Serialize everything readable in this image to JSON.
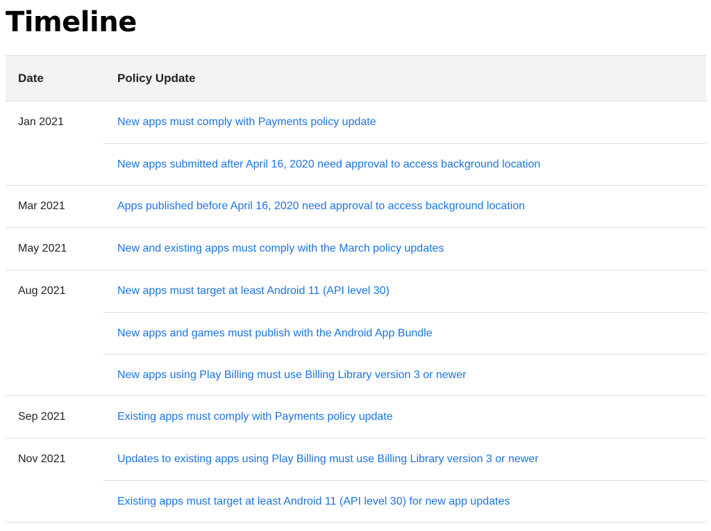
{
  "page": {
    "title": "Timeline"
  },
  "table": {
    "headers": {
      "date": "Date",
      "update": "Policy Update"
    },
    "groups": [
      {
        "date": "Jan 2021",
        "updates": [
          "New apps must comply with Payments policy update",
          "New apps submitted after April 16, 2020 need approval to access background location"
        ]
      },
      {
        "date": "Mar 2021",
        "updates": [
          "Apps published before April 16, 2020 need approval to access background location"
        ]
      },
      {
        "date": "May 2021",
        "updates": [
          "New and existing apps must comply with the March policy updates"
        ]
      },
      {
        "date": "Aug 2021",
        "updates": [
          "New apps must target at least Android 11 (API level 30)",
          "New apps and games must publish with the Android App Bundle",
          "New apps using Play Billing must use Billing Library version 3 or newer"
        ]
      },
      {
        "date": "Sep 2021",
        "updates": [
          "Existing apps must comply with Payments policy update"
        ]
      },
      {
        "date": "Nov 2021",
        "updates": [
          "Updates to existing apps using Play Billing must use Billing Library version 3 or newer",
          "Existing apps must target at least Android 11 (API level 30) for new app updates"
        ]
      }
    ]
  },
  "colors": {
    "link": "#1a73e8",
    "header_bg": "#f1f3f4",
    "divider": "#dadce0",
    "text": "#202124"
  }
}
